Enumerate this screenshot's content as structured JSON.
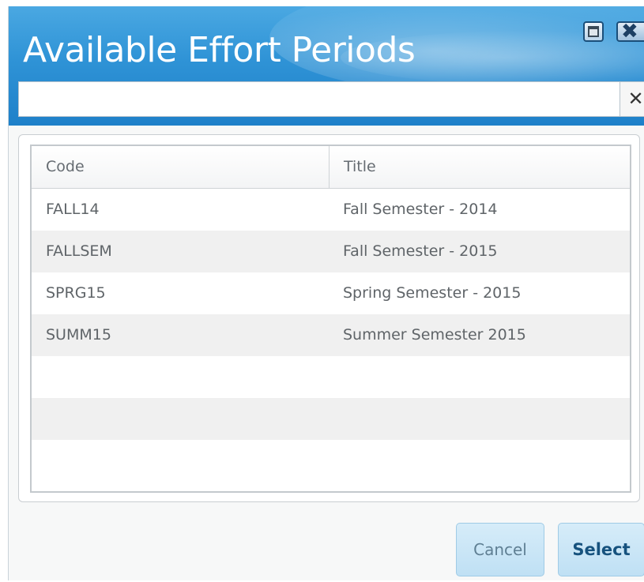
{
  "dialog": {
    "title": "Available Effort Periods",
    "controls": {
      "maximize_icon": "maximize-icon",
      "close_icon": "close-icon",
      "close_glyph": "✖"
    }
  },
  "search": {
    "value": "",
    "placeholder": "",
    "clear_glyph": "✕"
  },
  "grid": {
    "columns": [
      "Code",
      "Title"
    ],
    "rows": [
      {
        "code": "FALL14",
        "title": "Fall Semester - 2014"
      },
      {
        "code": "FALLSEM",
        "title": "Fall Semester - 2015"
      },
      {
        "code": "SPRG15",
        "title": "Spring Semester - 2015"
      },
      {
        "code": "SUMM15",
        "title": "Summer Semester 2015"
      },
      {
        "code": "",
        "title": ""
      },
      {
        "code": "",
        "title": ""
      },
      {
        "code": "",
        "title": ""
      }
    ]
  },
  "footer": {
    "cancel_label": "Cancel",
    "select_label": "Select"
  },
  "colors": {
    "titlebar": "#2f93d6",
    "button_fill": "#c9e6f7",
    "select_text": "#16527e"
  }
}
